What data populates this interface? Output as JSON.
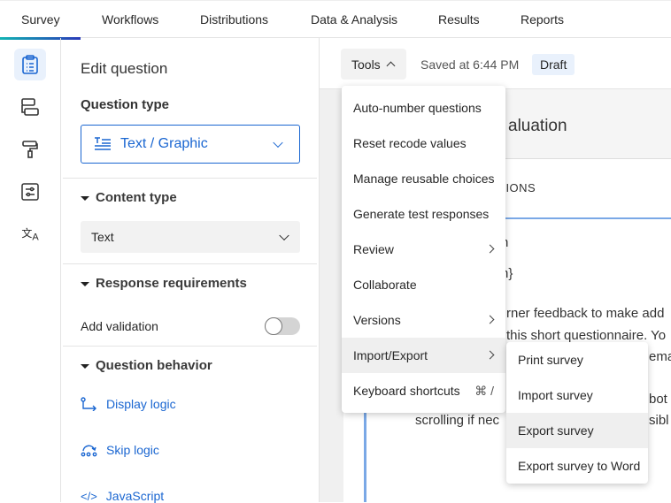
{
  "topnav": {
    "tabs": [
      "Survey",
      "Workflows",
      "Distributions",
      "Data & Analysis",
      "Results",
      "Reports"
    ],
    "active": "Survey"
  },
  "rail": {
    "icons": [
      "survey-clipboard-icon",
      "survey-flow-icon",
      "look-and-feel-paint-roller-icon",
      "survey-options-icon",
      "translate-icon"
    ]
  },
  "panel": {
    "title": "Edit question",
    "question_type_label": "Question type",
    "question_type_value": "Text / Graphic",
    "content_type_label": "Content type",
    "content_type_value": "Text",
    "response_requirements_label": "Response requirements",
    "add_validation_label": "Add validation",
    "add_validation_on": false,
    "question_behavior_label": "Question behavior",
    "links": [
      "Display logic",
      "Skip logic",
      "JavaScript"
    ]
  },
  "toolbar": {
    "tools_label": "Tools",
    "saved": "Saved at 6:44 PM",
    "status": "Draft"
  },
  "survey": {
    "title_fragment": "aluation",
    "tab_fragment": "TIONS",
    "text_lines": [
      "n",
      "n}",
      "rner feedback to make add",
      "this short questionnaire. Yo",
      "ema",
      "bot",
      "scrolling if nec",
      "sibl"
    ]
  },
  "tools_menu": {
    "items": [
      {
        "label": "Auto-number questions"
      },
      {
        "label": "Reset recode values"
      },
      {
        "label": "Manage reusable choices"
      },
      {
        "label": "Generate test responses"
      },
      {
        "label": "Review",
        "submenu": true
      },
      {
        "label": "Collaborate"
      },
      {
        "label": "Versions",
        "submenu": true
      },
      {
        "label": "Import/Export",
        "submenu": true,
        "highlighted": true
      },
      {
        "label": "Keyboard shortcuts",
        "shortcut": "⌘ /"
      }
    ]
  },
  "import_export_menu": {
    "items": [
      {
        "label": "Print survey"
      },
      {
        "label": "Import survey"
      },
      {
        "label": "Export survey",
        "highlighted": true
      },
      {
        "label": "Export survey to Word"
      }
    ]
  },
  "colors": {
    "accent": "#1a66d1",
    "highlight": "#efefef",
    "draft_bg": "#e9f1fc"
  }
}
